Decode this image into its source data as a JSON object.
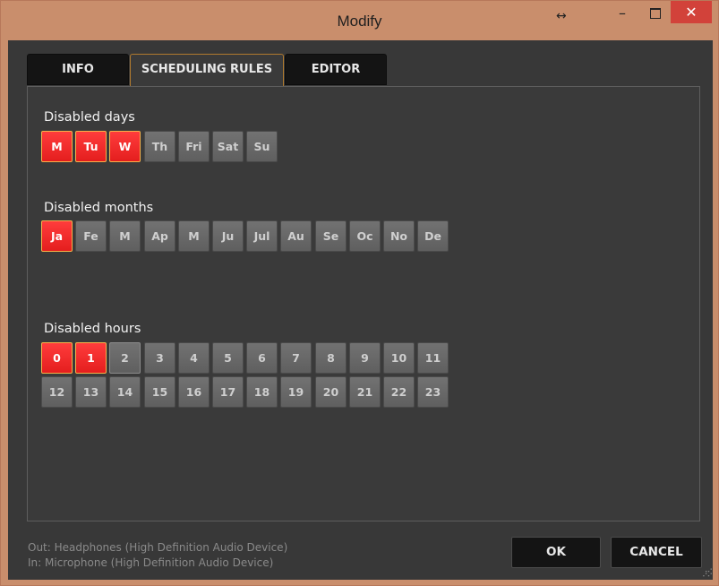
{
  "window": {
    "title": "Modify",
    "resize_glyph": "↔",
    "minimize_glyph": "–",
    "close_glyph": "✕"
  },
  "tabs": [
    {
      "label": "INFO",
      "active": false
    },
    {
      "label": "SCHEDULING RULES",
      "active": true
    },
    {
      "label": "EDITOR",
      "active": false
    }
  ],
  "disabled_days": {
    "label": "Disabled days",
    "items": [
      {
        "label": "M",
        "on": true
      },
      {
        "label": "Tu",
        "on": true
      },
      {
        "label": "W",
        "on": true
      },
      {
        "label": "Th",
        "on": false
      },
      {
        "label": "Fri",
        "on": false
      },
      {
        "label": "Sat",
        "on": false
      },
      {
        "label": "Su",
        "on": false
      }
    ]
  },
  "disabled_months": {
    "label": "Disabled months",
    "items": [
      {
        "label": "Ja",
        "on": true
      },
      {
        "label": "Fe",
        "on": false
      },
      {
        "label": "M",
        "on": false
      },
      {
        "label": "Ap",
        "on": false
      },
      {
        "label": "M",
        "on": false
      },
      {
        "label": "Ju",
        "on": false
      },
      {
        "label": "Jul",
        "on": false
      },
      {
        "label": "Au",
        "on": false
      },
      {
        "label": "Se",
        "on": false
      },
      {
        "label": "Oc",
        "on": false
      },
      {
        "label": "No",
        "on": false
      },
      {
        "label": "De",
        "on": false
      }
    ]
  },
  "disabled_hours": {
    "label": "Disabled hours",
    "items": [
      {
        "label": "0",
        "on": true
      },
      {
        "label": "1",
        "on": true
      },
      {
        "label": "2",
        "on": false,
        "hover": true
      },
      {
        "label": "3",
        "on": false
      },
      {
        "label": "4",
        "on": false
      },
      {
        "label": "5",
        "on": false
      },
      {
        "label": "6",
        "on": false
      },
      {
        "label": "7",
        "on": false
      },
      {
        "label": "8",
        "on": false
      },
      {
        "label": "9",
        "on": false
      },
      {
        "label": "10",
        "on": false
      },
      {
        "label": "11",
        "on": false
      },
      {
        "label": "12",
        "on": false
      },
      {
        "label": "13",
        "on": false
      },
      {
        "label": "14",
        "on": false
      },
      {
        "label": "15",
        "on": false
      },
      {
        "label": "16",
        "on": false
      },
      {
        "label": "17",
        "on": false
      },
      {
        "label": "18",
        "on": false
      },
      {
        "label": "19",
        "on": false
      },
      {
        "label": "20",
        "on": false
      },
      {
        "label": "21",
        "on": false
      },
      {
        "label": "22",
        "on": false
      },
      {
        "label": "23",
        "on": false
      }
    ]
  },
  "status": {
    "out": "Out: Headphones (High Definition Audio Device)",
    "in": "In: Microphone (High Definition Audio Device)"
  },
  "buttons": {
    "ok": "OK",
    "cancel": "CANCEL"
  },
  "colors": {
    "selected": "#f03030",
    "selected_border": "#f5b24a",
    "chip": "#686868",
    "background": "#383838",
    "titlebar": "#c98e6c",
    "close": "#d2423a"
  }
}
